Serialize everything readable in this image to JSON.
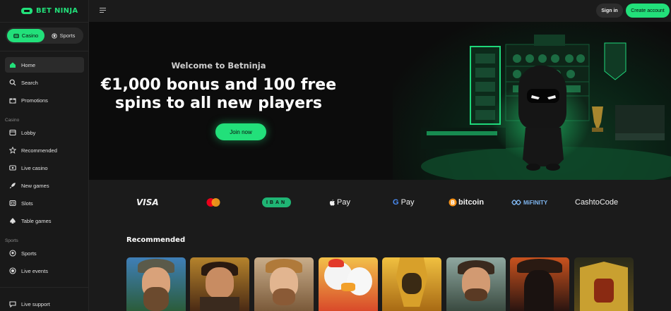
{
  "brand": {
    "name": "BET NINJA",
    "color": "#22e07a"
  },
  "switch": {
    "casino": "Casino",
    "sports": "Sports"
  },
  "nav": {
    "home": "Home",
    "search": "Search",
    "promotions": "Promotions",
    "casino_section": "Casino",
    "lobby": "Lobby",
    "recommended": "Recommended",
    "live_casino": "Live casino",
    "new_games": "New games",
    "slots": "Slots",
    "table_games": "Table games",
    "sports_section": "Sports",
    "sports": "Sports",
    "live_events": "Live events",
    "live_support": "Live support"
  },
  "header": {
    "sign_in": "Sign in",
    "create_account": "Create account"
  },
  "hero": {
    "welcome": "Welcome to Betninja",
    "headline_line1": "€1,000 bonus and 100 free",
    "headline_line2": "spins to all new players",
    "cta": "Join now"
  },
  "payments": {
    "visa": "VISA",
    "iban": "IBAN",
    "apple_pay": "Pay",
    "google_pay": "Pay",
    "bitcoin": "bitcoin",
    "mifinity": "MiFINITY",
    "cashtocode": "CashtoCode"
  },
  "recommended": {
    "title": "Recommended"
  },
  "icons": [
    "home-icon",
    "search-icon",
    "gift-icon",
    "lobby-icon",
    "star-icon",
    "live-casino-icon",
    "rocket-icon",
    "slots-icon",
    "spade-icon",
    "ball-icon",
    "live-dot-icon",
    "chat-icon"
  ]
}
